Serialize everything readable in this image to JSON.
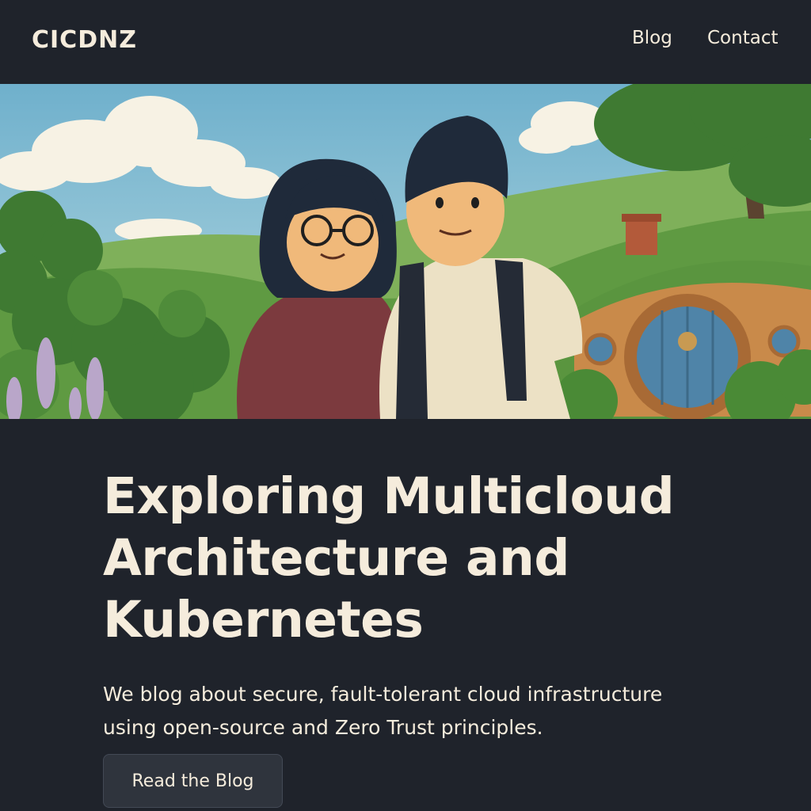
{
  "nav": {
    "logo": "CICDNZ",
    "links": [
      {
        "label": "Blog"
      },
      {
        "label": "Contact"
      }
    ]
  },
  "hero": {
    "illustration": "couple-in-green-hills-with-hobbit-house"
  },
  "main": {
    "headline_lines": [
      "Exploring Multicloud",
      "Architecture and",
      "Kubernetes"
    ],
    "subtext_lines": [
      "We blog about secure, fault-tolerant cloud infrastructure",
      "using open-source and Zero Trust principles."
    ],
    "cta_label": "Read the Blog"
  },
  "colors": {
    "background": "#1f232b",
    "text": "#f5ecdc",
    "button_bg": "#2f343d"
  }
}
